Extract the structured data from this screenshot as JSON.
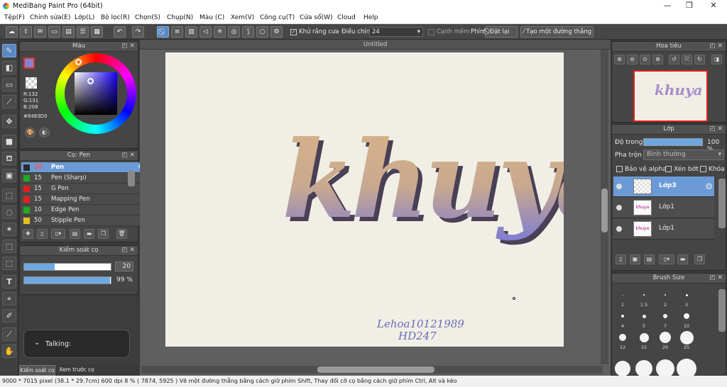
{
  "app": {
    "title": "MediBang Paint Pro (64bit)"
  },
  "window_controls": {
    "minimize": "—",
    "maximize": "❐",
    "close": "✕"
  },
  "menu": [
    "Tệp(F)",
    "Chỉnh sửa(E)",
    "Lớp(L)",
    "Bộ lọc(R)",
    "Chọn(S)",
    "Chụp(N)",
    "Màu (C)",
    "Xem(V)",
    "Công cụ(T)",
    "Cửa sổ(W)",
    "Cloud",
    "Help"
  ],
  "toolbar": {
    "antialias_label": "Khử răng cưa",
    "adjust_label": "Điều chỉnh",
    "adjust_value": "24",
    "edge_label": "Cạnh mềm",
    "key_label": "Phím",
    "reset_label": "Đặt lại",
    "straight_line_label": "Tạo một đường thẳng"
  },
  "color_panel": {
    "title": "Màu",
    "r": "R:132",
    "g": "G:131",
    "b": "B:208",
    "hex": "#8483D0",
    "primary_color": "#8483D0"
  },
  "brush_panel": {
    "title": "Cọ: Pen",
    "items": [
      {
        "size": "20",
        "name": "Pen",
        "color": "#2a2a2a",
        "selected": true
      },
      {
        "size": "15",
        "name": "Pen (Sharp)",
        "color": "#22aa22"
      },
      {
        "size": "15",
        "name": "G Pen",
        "color": "#e02020"
      },
      {
        "size": "15",
        "name": "Mapping Pen",
        "color": "#e02020"
      },
      {
        "size": "10",
        "name": "Edge Pen",
        "color": "#22aa22"
      },
      {
        "size": "50",
        "name": "Stipple Pen",
        "color": "#e6c020"
      }
    ]
  },
  "brush_control": {
    "title": "Kiểm soát cọ",
    "size_value": "20",
    "size_fraction": 0.35,
    "opacity_value": "99 %",
    "opacity_fraction": 0.99
  },
  "talking": {
    "label": "Talking:"
  },
  "bottom_tabs": {
    "tab1": "Kiểm soát cọ",
    "tab2": "Xem trước cọ"
  },
  "canvas": {
    "tab": "Untitled",
    "artwork_text": "khuya",
    "signature_line1": "Lehoa10121989",
    "signature_line2": "HD247"
  },
  "navigator": {
    "title": "Hoa tiêu"
  },
  "layer_panel": {
    "title": "Lớp",
    "opacity_label": "Độ trong",
    "opacity_value": "100 %",
    "blend_label": "Pha trộn",
    "blend_value": "Bình thường",
    "protect_alpha": "Bảo vệ alpha",
    "clip": "Xén bớt",
    "lock": "Khóa",
    "layers": [
      {
        "name": "Lớp3",
        "selected": true
      },
      {
        "name": "Lớp1",
        "selected": false
      },
      {
        "name": "Lớp1",
        "selected": false
      }
    ]
  },
  "brush_size_panel": {
    "title": "Brush Size",
    "sizes": [
      "1",
      "1.5",
      "2",
      "3",
      "4",
      "5",
      "7",
      "10",
      "12",
      "15",
      "20",
      "25"
    ]
  },
  "status": {
    "text": "9000 * 7015 pixel   (38.1 * 29.7cm)   600 dpi   8 %   ( 7874, 5925 )   Vẽ một đường thẳng bằng cách giữ phím Shift, Thay đổi cỡ cọ bằng cách giữ phím Ctrl, Alt và kéo"
  }
}
